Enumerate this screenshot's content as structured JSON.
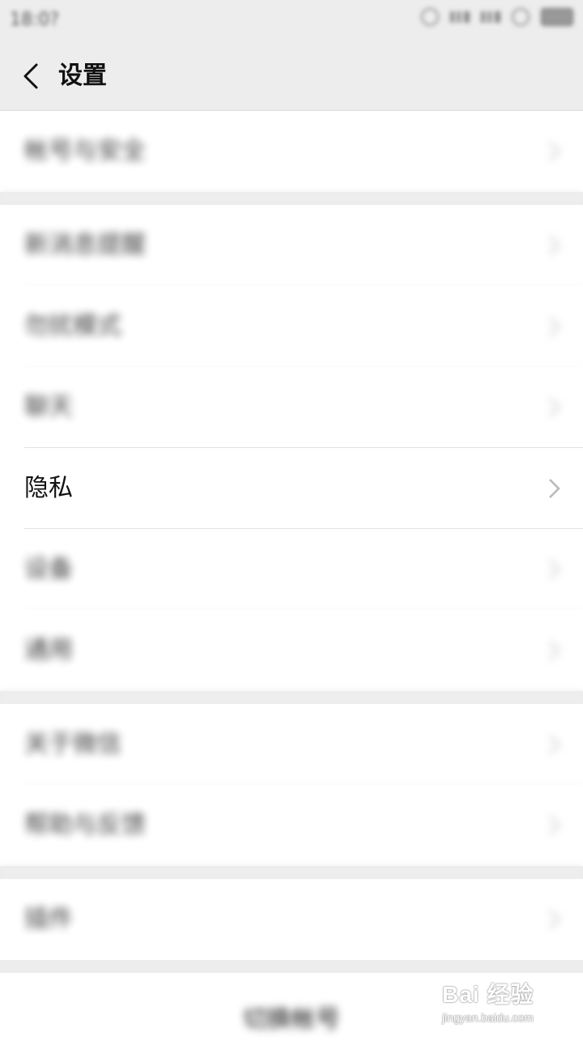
{
  "status_bar": {
    "time": "18:0?"
  },
  "header": {
    "title": "设置"
  },
  "groups": [
    {
      "items": [
        {
          "label": "帐号与安全"
        }
      ]
    },
    {
      "items": [
        {
          "label": "新消息提醒"
        },
        {
          "label": "勿扰模式"
        },
        {
          "label": "聊天"
        },
        {
          "label": "隐私"
        },
        {
          "label": "设备"
        },
        {
          "label": "通用"
        }
      ]
    },
    {
      "items": [
        {
          "label": "关于微信"
        },
        {
          "label": "帮助与反馈"
        }
      ]
    },
    {
      "items": [
        {
          "label": "插件"
        }
      ]
    }
  ],
  "logout": {
    "label": "切换帐号"
  },
  "watermark": {
    "logo": "Bai 经验",
    "url": "jingyan.baidu.com"
  }
}
